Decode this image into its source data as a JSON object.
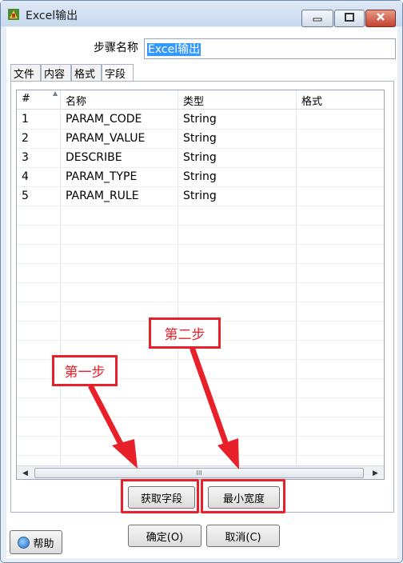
{
  "window": {
    "title": "Excel输出"
  },
  "step": {
    "label": "步骤名称",
    "value": "Excel输出"
  },
  "tabs": [
    {
      "label": "文件"
    },
    {
      "label": "内容"
    },
    {
      "label": "格式"
    },
    {
      "label": "字段"
    }
  ],
  "active_tab": "字段",
  "table": {
    "headers": [
      "#",
      "名称",
      "类型",
      "格式"
    ],
    "rows": [
      {
        "num": "1",
        "name": "PARAM_CODE",
        "type": "String"
      },
      {
        "num": "2",
        "name": "PARAM_VALUE",
        "type": "String"
      },
      {
        "num": "3",
        "name": "DESCRIBE",
        "type": "String"
      },
      {
        "num": "4",
        "name": "PARAM_TYPE",
        "type": "String"
      },
      {
        "num": "5",
        "name": "PARAM_RULE",
        "type": "String"
      }
    ],
    "scroll_thumb": "III"
  },
  "buttons": {
    "get_fields": "获取字段",
    "min_width": "最小宽度",
    "ok": "确定(O)",
    "cancel": "取消(C)",
    "help": "帮助"
  },
  "annotations": {
    "step1": "第一步",
    "step2": "第二步",
    "color": "#e8202a"
  },
  "icons": {
    "app": "spoon-app-icon",
    "minimize": "minimize-icon",
    "maximize": "maximize-icon",
    "close": "close-icon",
    "help": "help-icon",
    "sort": "sort-up-icon",
    "scroll_left": "arrow-left-icon",
    "scroll_right": "arrow-right-icon"
  }
}
